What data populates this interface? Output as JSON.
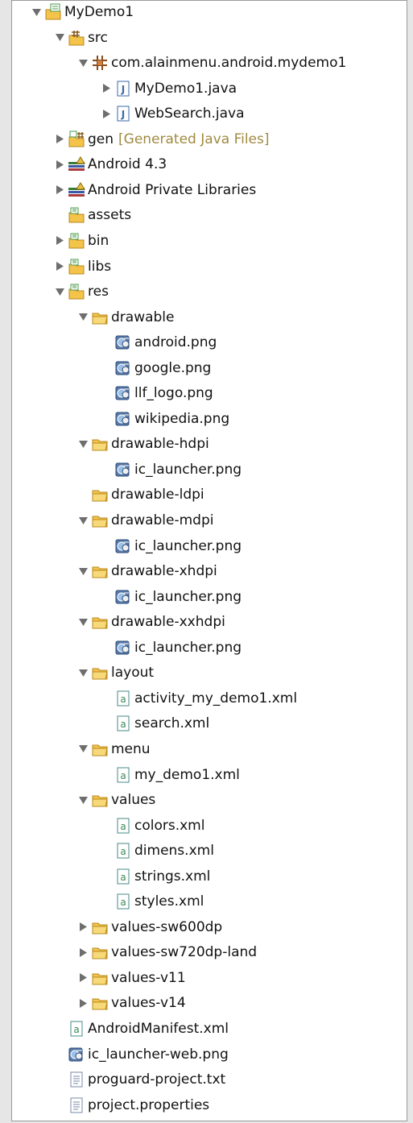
{
  "tree": [
    {
      "label": "MyDemo1",
      "icon": "project-folder-icon",
      "depth": 0,
      "toggle": "expanded"
    },
    {
      "label": "src",
      "icon": "source-folder-icon",
      "depth": 1,
      "toggle": "expanded"
    },
    {
      "label": "com.alainmenu.android.mydemo1",
      "icon": "package-icon",
      "depth": 2,
      "toggle": "expanded"
    },
    {
      "label": "MyDemo1.java",
      "icon": "java-file-icon",
      "depth": 3,
      "toggle": "collapsed"
    },
    {
      "label": "WebSearch.java",
      "icon": "java-file-icon",
      "depth": 3,
      "toggle": "collapsed"
    },
    {
      "label": "gen",
      "suffix": "[Generated Java Files]",
      "icon": "generated-folder-icon",
      "depth": 1,
      "toggle": "collapsed"
    },
    {
      "label": "Android 4.3",
      "icon": "library-icon",
      "depth": 1,
      "toggle": "collapsed"
    },
    {
      "label": "Android Private Libraries",
      "icon": "library-icon",
      "depth": 1,
      "toggle": "collapsed"
    },
    {
      "label": "assets",
      "icon": "resource-folder-icon",
      "depth": 1,
      "toggle": "none"
    },
    {
      "label": "bin",
      "icon": "resource-folder-icon",
      "depth": 1,
      "toggle": "collapsed"
    },
    {
      "label": "libs",
      "icon": "resource-folder-icon",
      "depth": 1,
      "toggle": "collapsed"
    },
    {
      "label": "res",
      "icon": "resource-folder-icon",
      "depth": 1,
      "toggle": "expanded"
    },
    {
      "label": "drawable",
      "icon": "folder-icon",
      "depth": 2,
      "toggle": "expanded"
    },
    {
      "label": "android.png",
      "icon": "image-file-icon",
      "depth": 3,
      "toggle": "none"
    },
    {
      "label": "google.png",
      "icon": "image-file-icon",
      "depth": 3,
      "toggle": "none"
    },
    {
      "label": "llf_logo.png",
      "icon": "image-file-icon",
      "depth": 3,
      "toggle": "none"
    },
    {
      "label": "wikipedia.png",
      "icon": "image-file-icon",
      "depth": 3,
      "toggle": "none"
    },
    {
      "label": "drawable-hdpi",
      "icon": "folder-icon",
      "depth": 2,
      "toggle": "expanded"
    },
    {
      "label": "ic_launcher.png",
      "icon": "image-file-icon",
      "depth": 3,
      "toggle": "none"
    },
    {
      "label": "drawable-ldpi",
      "icon": "folder-icon",
      "depth": 2,
      "toggle": "none"
    },
    {
      "label": "drawable-mdpi",
      "icon": "folder-icon",
      "depth": 2,
      "toggle": "expanded"
    },
    {
      "label": "ic_launcher.png",
      "icon": "image-file-icon",
      "depth": 3,
      "toggle": "none"
    },
    {
      "label": "drawable-xhdpi",
      "icon": "folder-icon",
      "depth": 2,
      "toggle": "expanded"
    },
    {
      "label": "ic_launcher.png",
      "icon": "image-file-icon",
      "depth": 3,
      "toggle": "none"
    },
    {
      "label": "drawable-xxhdpi",
      "icon": "folder-icon",
      "depth": 2,
      "toggle": "expanded"
    },
    {
      "label": "ic_launcher.png",
      "icon": "image-file-icon",
      "depth": 3,
      "toggle": "none"
    },
    {
      "label": "layout",
      "icon": "folder-icon",
      "depth": 2,
      "toggle": "expanded"
    },
    {
      "label": "activity_my_demo1.xml",
      "icon": "xml-file-icon",
      "depth": 3,
      "toggle": "none"
    },
    {
      "label": "search.xml",
      "icon": "xml-file-icon",
      "depth": 3,
      "toggle": "none"
    },
    {
      "label": "menu",
      "icon": "folder-icon",
      "depth": 2,
      "toggle": "expanded"
    },
    {
      "label": "my_demo1.xml",
      "icon": "xml-file-icon",
      "depth": 3,
      "toggle": "none"
    },
    {
      "label": "values",
      "icon": "folder-icon",
      "depth": 2,
      "toggle": "expanded"
    },
    {
      "label": "colors.xml",
      "icon": "xml-file-icon",
      "depth": 3,
      "toggle": "none"
    },
    {
      "label": "dimens.xml",
      "icon": "xml-file-icon",
      "depth": 3,
      "toggle": "none"
    },
    {
      "label": "strings.xml",
      "icon": "xml-file-icon",
      "depth": 3,
      "toggle": "none"
    },
    {
      "label": "styles.xml",
      "icon": "xml-file-icon",
      "depth": 3,
      "toggle": "none"
    },
    {
      "label": "values-sw600dp",
      "icon": "folder-icon",
      "depth": 2,
      "toggle": "collapsed"
    },
    {
      "label": "values-sw720dp-land",
      "icon": "folder-icon",
      "depth": 2,
      "toggle": "collapsed"
    },
    {
      "label": "values-v11",
      "icon": "folder-icon",
      "depth": 2,
      "toggle": "collapsed"
    },
    {
      "label": "values-v14",
      "icon": "folder-icon",
      "depth": 2,
      "toggle": "collapsed"
    },
    {
      "label": "AndroidManifest.xml",
      "icon": "xml-file-icon",
      "depth": 1,
      "toggle": "none"
    },
    {
      "label": "ic_launcher-web.png",
      "icon": "image-file-icon",
      "depth": 1,
      "toggle": "none"
    },
    {
      "label": "proguard-project.txt",
      "icon": "text-file-icon",
      "depth": 1,
      "toggle": "none"
    },
    {
      "label": "project.properties",
      "icon": "text-file-icon",
      "depth": 1,
      "toggle": "none"
    }
  ],
  "colors": {
    "folder": "#f3c34a",
    "folder_edge": "#b88a1e",
    "suffix_text": "#a08a40",
    "toggle": "#6e6e6e"
  }
}
